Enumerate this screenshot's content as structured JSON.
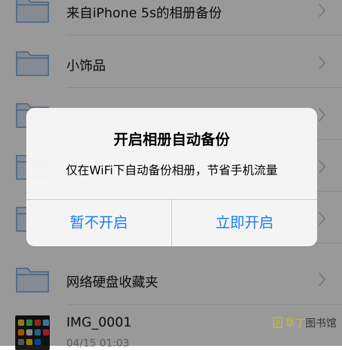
{
  "albums": [
    {
      "label": "来自iPhone 5s的相册备份"
    },
    {
      "label": "小饰品"
    },
    {
      "label": ""
    },
    {
      "label": ""
    },
    {
      "label": ""
    },
    {
      "label": "网络硬盘收藏夹"
    }
  ],
  "photo": {
    "title": "IMG_0001",
    "date": "04/15 01:03"
  },
  "alert": {
    "title": "开启相册自动备份",
    "message": "仅在WiFi下自动备份相册，节省手机流量",
    "cancel_label": "暂不开启",
    "confirm_label": "立即开启"
  },
  "watermark": {
    "part1": "草丁",
    "part2": "图书馆"
  },
  "colors": {
    "accent": "#1a7cf5",
    "folder": "#6d9fd6",
    "separator": "#e2e2e2"
  },
  "icons": {
    "row": "folder-icon",
    "disclosure": "chevron-right-icon"
  }
}
